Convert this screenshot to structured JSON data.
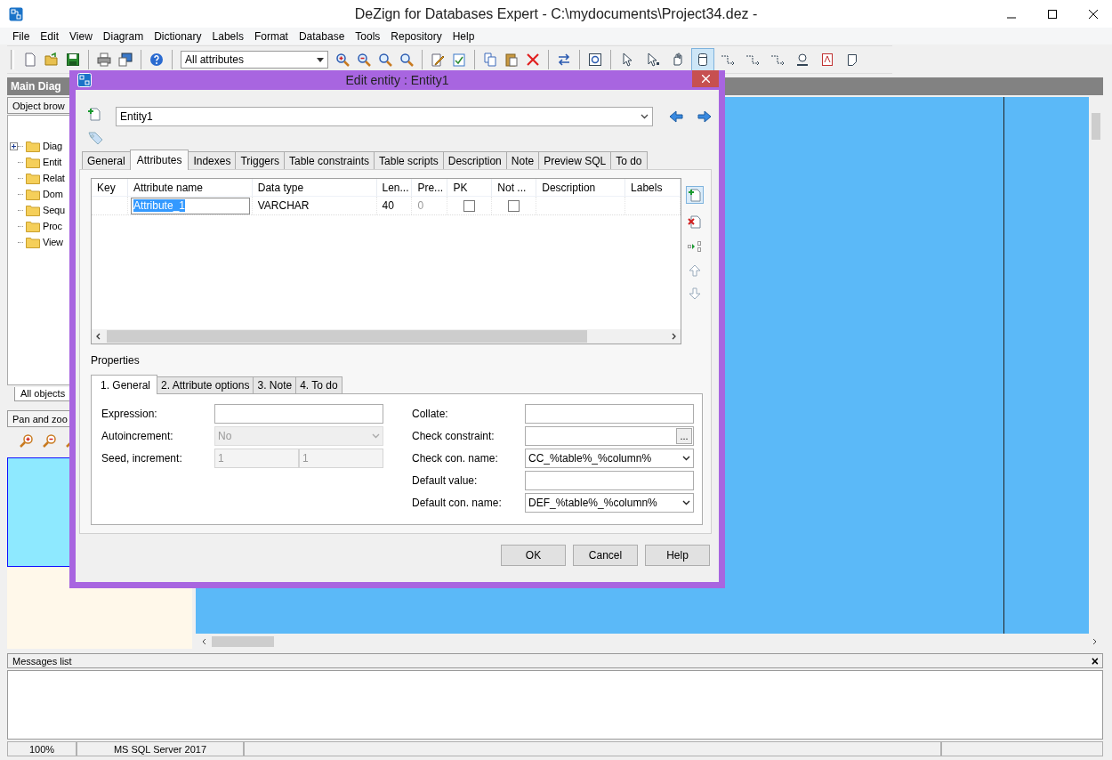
{
  "window": {
    "title": "DeZign for Databases Expert - C:\\mydocuments\\Project34.dez -"
  },
  "menu": [
    "File",
    "Edit",
    "View",
    "Diagram",
    "Dictionary",
    "Labels",
    "Format",
    "Database",
    "Tools",
    "Repository",
    "Help"
  ],
  "toolbar": {
    "view_select": "All attributes",
    "tools": [
      {
        "selected": false
      },
      {
        "selected": false
      },
      {
        "selected": false
      },
      {
        "selected": true
      },
      {
        "selected": false
      },
      {
        "selected": false
      },
      {
        "selected": false
      },
      {
        "selected": false
      },
      {
        "selected": false
      },
      {
        "selected": false
      }
    ]
  },
  "main_panel": {
    "title": "Main Diag"
  },
  "object_browser": {
    "title": "Object brow",
    "tree": [
      {
        "label": "Diag",
        "expandable": true
      },
      {
        "label": "Entit",
        "expandable": false
      },
      {
        "label": "Relat",
        "expandable": false
      },
      {
        "label": "Dom",
        "expandable": false
      },
      {
        "label": "Sequ",
        "expandable": false
      },
      {
        "label": "Proc",
        "expandable": false
      },
      {
        "label": "View",
        "expandable": false
      }
    ],
    "tab": "All objects"
  },
  "pan_zoom": {
    "title": "Pan and zoo"
  },
  "dialog": {
    "title": "Edit entity : Entity1",
    "entity_name": "Entity1",
    "tabs": [
      {
        "label": "General",
        "selected": false
      },
      {
        "label": "Attributes",
        "selected": true
      },
      {
        "label": "Indexes",
        "selected": false
      },
      {
        "label": "Triggers",
        "selected": false
      },
      {
        "label": "Table constraints",
        "selected": false
      },
      {
        "label": "Table scripts",
        "selected": false
      },
      {
        "label": "Description",
        "selected": false
      },
      {
        "label": "Note",
        "selected": false
      },
      {
        "label": "Preview SQL",
        "selected": false
      },
      {
        "label": "To do",
        "selected": false
      }
    ],
    "table": {
      "columns": [
        "Key",
        "Attribute name",
        "Data type",
        "Len...",
        "Pre...",
        "PK",
        "Not ...",
        "Description",
        "Labels"
      ],
      "rows": [
        {
          "attribute_name": "Attribute_1",
          "data_type": "VARCHAR",
          "length": "40",
          "precision": "0",
          "pk": false,
          "not_null": false
        }
      ]
    },
    "properties": {
      "title": "Properties",
      "tabs": [
        {
          "label": "1. General",
          "selected": true
        },
        {
          "label": "2. Attribute options",
          "selected": false
        },
        {
          "label": "3. Note",
          "selected": false
        },
        {
          "label": "4. To do",
          "selected": false
        }
      ],
      "fields_left": [
        {
          "label": "Expression:",
          "kind": "text",
          "disabled": false
        },
        {
          "label": "Autoincrement:",
          "kind": "select",
          "value": "No",
          "disabled": true
        },
        {
          "label": "Seed, increment:",
          "kind": "pair",
          "values": [
            "1",
            "1"
          ],
          "disabled": true
        }
      ],
      "fields_right": [
        {
          "label": "Collate:",
          "kind": "text",
          "disabled": false
        },
        {
          "label": "Check constraint:",
          "kind": "browse",
          "button": "...",
          "disabled": false
        },
        {
          "label": "Check con. name:",
          "kind": "select",
          "value": "CC_%table%_%column%",
          "disabled": false
        },
        {
          "label": "Default value:",
          "kind": "text",
          "disabled": false
        },
        {
          "label": "Default con. name:",
          "kind": "select",
          "value": "DEF_%table%_%column%",
          "disabled": false
        }
      ]
    },
    "buttons": [
      "OK",
      "Cancel",
      "Help"
    ]
  },
  "messages": {
    "title": "Messages list",
    "close": "×"
  },
  "status_bar": [
    "100%",
    "MS SQL Server 2017"
  ]
}
